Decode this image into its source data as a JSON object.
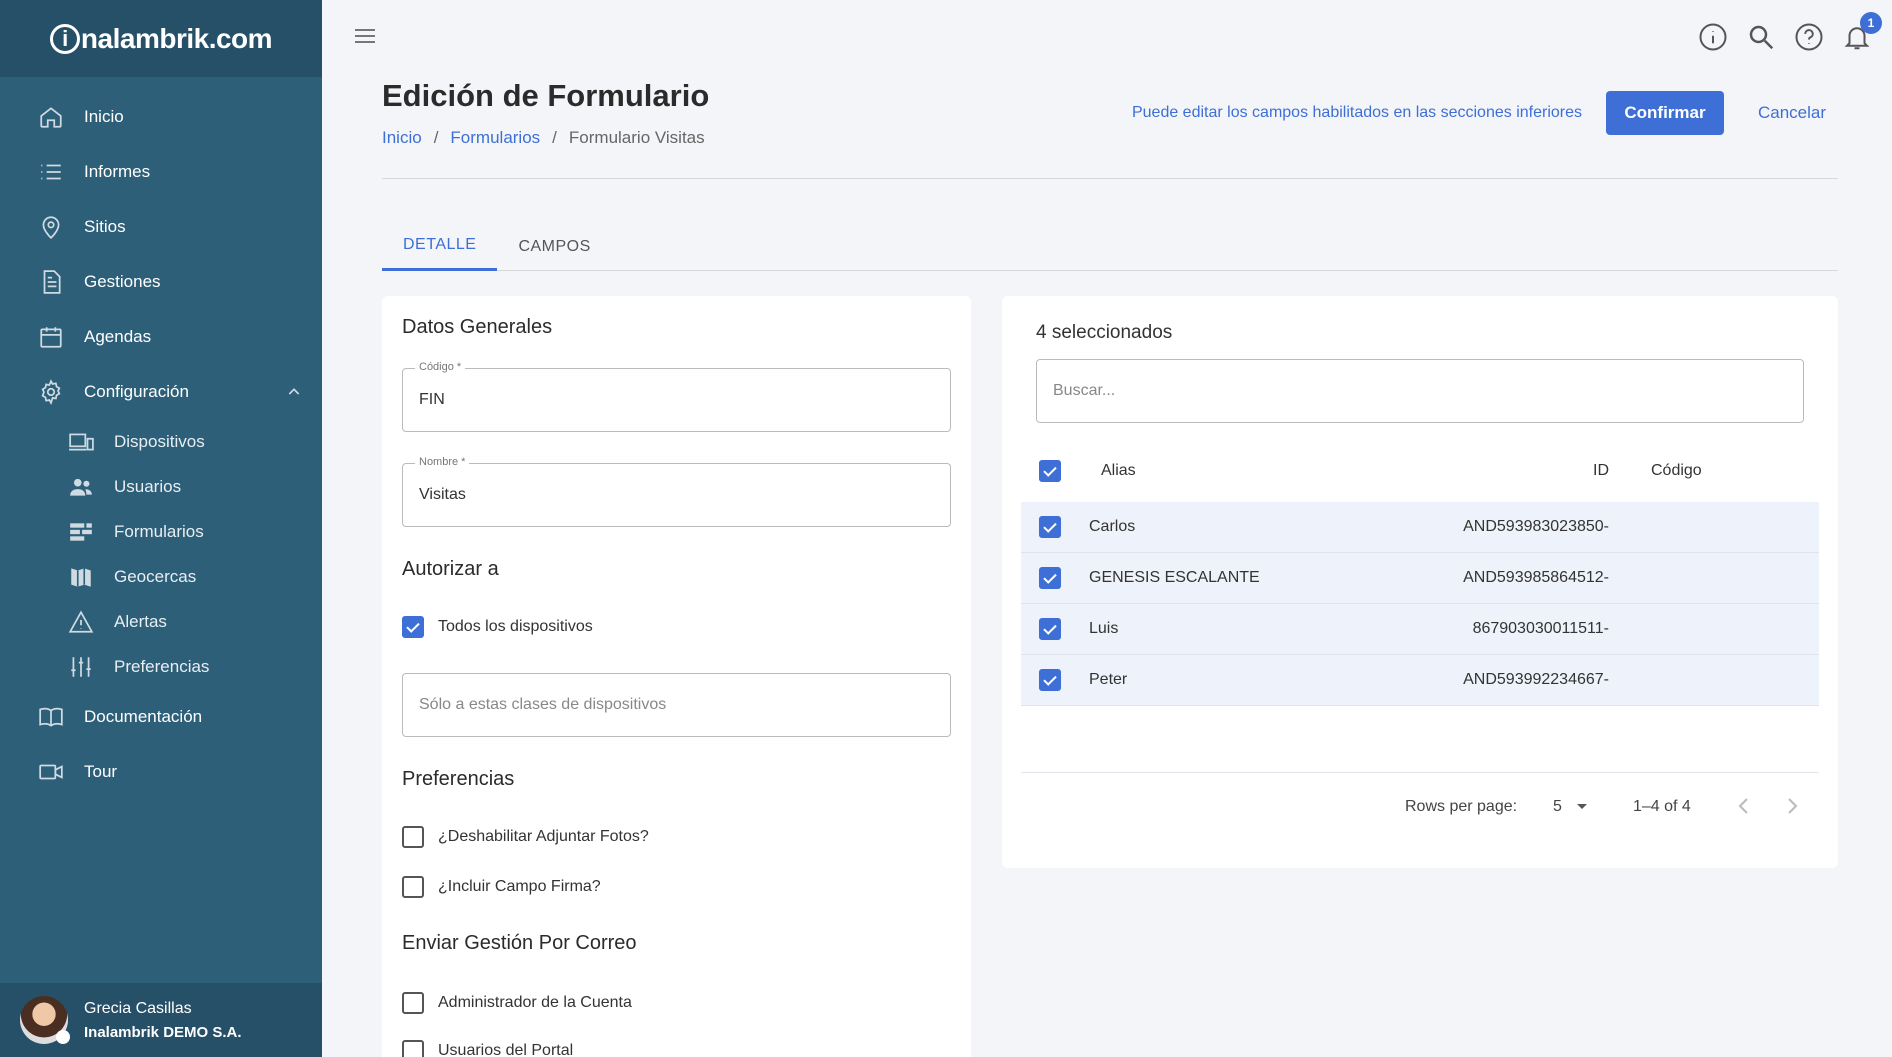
{
  "brand": {
    "logo_i": "i",
    "logo_rest": "nalambrik.com"
  },
  "sidebar": {
    "items": [
      {
        "label": "Inicio",
        "icon": "home-icon"
      },
      {
        "label": "Informes",
        "icon": "list-icon"
      },
      {
        "label": "Sitios",
        "icon": "location-pin-icon"
      },
      {
        "label": "Gestiones",
        "icon": "document-icon"
      },
      {
        "label": "Agendas",
        "icon": "calendar-icon"
      },
      {
        "label": "Configuración",
        "icon": "gear-icon"
      }
    ],
    "sub_items": [
      {
        "label": "Dispositivos",
        "icon": "devices-icon"
      },
      {
        "label": "Usuarios",
        "icon": "users-icon"
      },
      {
        "label": "Formularios",
        "icon": "forms-icon"
      },
      {
        "label": "Geocercas",
        "icon": "map-icon"
      },
      {
        "label": "Alertas",
        "icon": "warning-icon"
      },
      {
        "label": "Preferencias",
        "icon": "sliders-icon"
      }
    ],
    "bottom_items": [
      {
        "label": "Documentación",
        "icon": "book-icon"
      },
      {
        "label": "Tour",
        "icon": "video-icon"
      }
    ],
    "user": {
      "name": "Grecia Casillas",
      "org": "Inalambrik DEMO S.A."
    }
  },
  "topbar": {
    "notification_count": "1"
  },
  "header": {
    "title": "Edición de Formulario",
    "breadcrumb": [
      "Inicio",
      "Formularios",
      "Formulario Visitas"
    ],
    "separator": "/",
    "hint": "Puede editar los campos habilitados en las secciones inferiores",
    "confirm_label": "Confirmar",
    "cancel_label": "Cancelar"
  },
  "tabs": [
    {
      "label": "DETALLE",
      "active": true
    },
    {
      "label": "CAMPOS",
      "active": false
    }
  ],
  "form": {
    "general_title": "Datos Generales",
    "codigo_label": "Código *",
    "codigo_value": "FIN",
    "nombre_label": "Nombre *",
    "nombre_value": "Visitas",
    "authorize_title": "Autorizar a",
    "all_devices_label": "Todos los dispositivos",
    "all_devices_checked": true,
    "device_classes_placeholder": "Sólo a estas clases de dispositivos",
    "prefs_title": "Preferencias",
    "pref_photos_label": "¿Deshabilitar Adjuntar Fotos?",
    "pref_signature_label": "¿Incluir Campo Firma?",
    "email_title": "Enviar Gestión Por Correo",
    "email_admin_label": "Administrador de la Cuenta",
    "email_portal_label": "Usuarios del Portal"
  },
  "devices_table": {
    "selected_text": "4 seleccionados",
    "search_placeholder": "Buscar...",
    "columns": {
      "alias": "Alias",
      "id": "ID",
      "code": "Código"
    },
    "rows": [
      {
        "alias": "Carlos",
        "id": "AND593983023850-",
        "code": "",
        "checked": true
      },
      {
        "alias": "GENESIS ESCALANTE",
        "id": "AND593985864512-",
        "code": "",
        "checked": true
      },
      {
        "alias": "Luis",
        "id": "867903030011511-",
        "code": "",
        "checked": true
      },
      {
        "alias": "Peter",
        "id": "AND593992234667-",
        "code": "",
        "checked": true
      }
    ],
    "rows_per_page_label": "Rows per page:",
    "rows_per_page_value": "5",
    "range_text": "1–4 of 4"
  },
  "colors": {
    "sidebar": "#2e5f79",
    "sidebar_dark": "#264f68",
    "accent": "#3d6fd6",
    "row_bg": "#eef2fa"
  }
}
